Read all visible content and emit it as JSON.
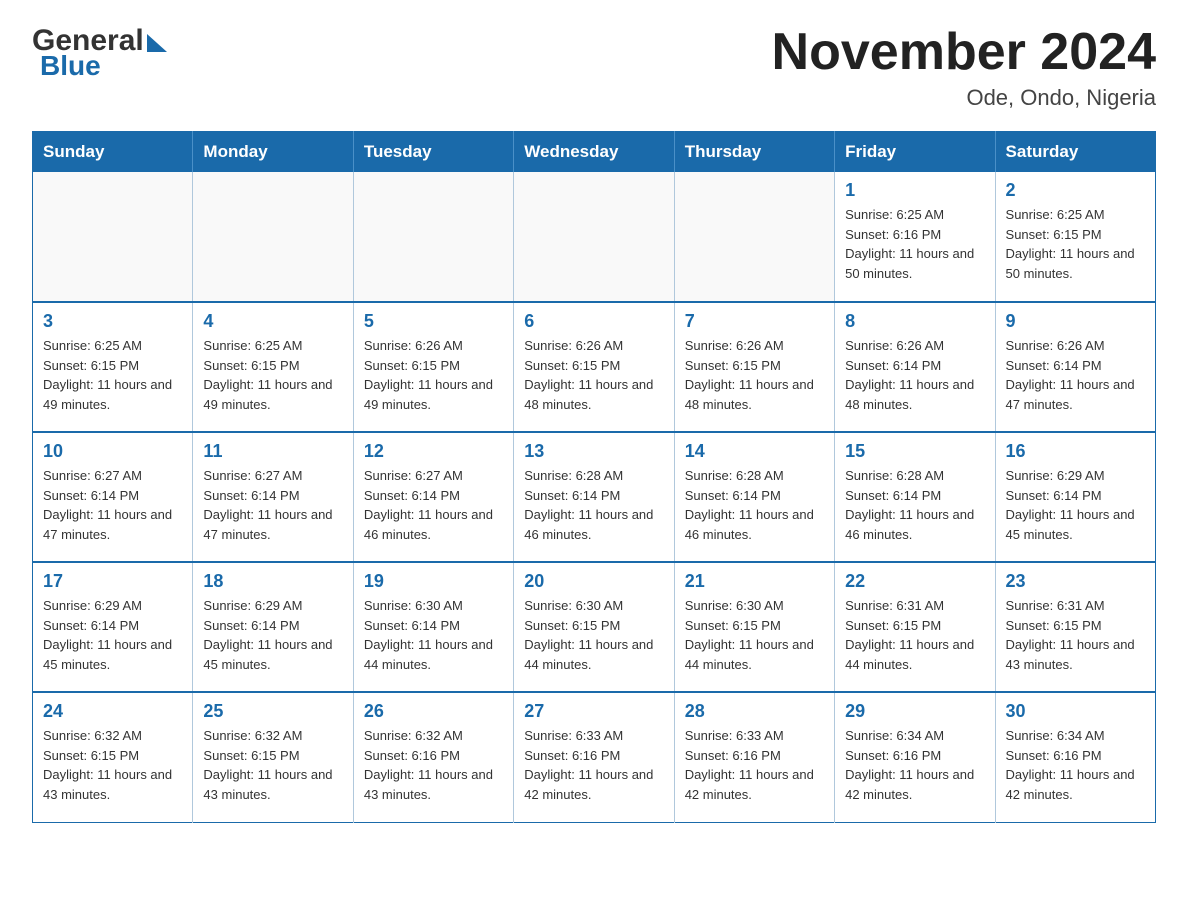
{
  "logo": {
    "general": "General",
    "blue": "Blue"
  },
  "header": {
    "title": "November 2024",
    "location": "Ode, Ondo, Nigeria"
  },
  "weekdays": [
    "Sunday",
    "Monday",
    "Tuesday",
    "Wednesday",
    "Thursday",
    "Friday",
    "Saturday"
  ],
  "weeks": [
    [
      {
        "day": "",
        "info": ""
      },
      {
        "day": "",
        "info": ""
      },
      {
        "day": "",
        "info": ""
      },
      {
        "day": "",
        "info": ""
      },
      {
        "day": "",
        "info": ""
      },
      {
        "day": "1",
        "info": "Sunrise: 6:25 AM\nSunset: 6:16 PM\nDaylight: 11 hours and 50 minutes."
      },
      {
        "day": "2",
        "info": "Sunrise: 6:25 AM\nSunset: 6:15 PM\nDaylight: 11 hours and 50 minutes."
      }
    ],
    [
      {
        "day": "3",
        "info": "Sunrise: 6:25 AM\nSunset: 6:15 PM\nDaylight: 11 hours and 49 minutes."
      },
      {
        "day": "4",
        "info": "Sunrise: 6:25 AM\nSunset: 6:15 PM\nDaylight: 11 hours and 49 minutes."
      },
      {
        "day": "5",
        "info": "Sunrise: 6:26 AM\nSunset: 6:15 PM\nDaylight: 11 hours and 49 minutes."
      },
      {
        "day": "6",
        "info": "Sunrise: 6:26 AM\nSunset: 6:15 PM\nDaylight: 11 hours and 48 minutes."
      },
      {
        "day": "7",
        "info": "Sunrise: 6:26 AM\nSunset: 6:15 PM\nDaylight: 11 hours and 48 minutes."
      },
      {
        "day": "8",
        "info": "Sunrise: 6:26 AM\nSunset: 6:14 PM\nDaylight: 11 hours and 48 minutes."
      },
      {
        "day": "9",
        "info": "Sunrise: 6:26 AM\nSunset: 6:14 PM\nDaylight: 11 hours and 47 minutes."
      }
    ],
    [
      {
        "day": "10",
        "info": "Sunrise: 6:27 AM\nSunset: 6:14 PM\nDaylight: 11 hours and 47 minutes."
      },
      {
        "day": "11",
        "info": "Sunrise: 6:27 AM\nSunset: 6:14 PM\nDaylight: 11 hours and 47 minutes."
      },
      {
        "day": "12",
        "info": "Sunrise: 6:27 AM\nSunset: 6:14 PM\nDaylight: 11 hours and 46 minutes."
      },
      {
        "day": "13",
        "info": "Sunrise: 6:28 AM\nSunset: 6:14 PM\nDaylight: 11 hours and 46 minutes."
      },
      {
        "day": "14",
        "info": "Sunrise: 6:28 AM\nSunset: 6:14 PM\nDaylight: 11 hours and 46 minutes."
      },
      {
        "day": "15",
        "info": "Sunrise: 6:28 AM\nSunset: 6:14 PM\nDaylight: 11 hours and 46 minutes."
      },
      {
        "day": "16",
        "info": "Sunrise: 6:29 AM\nSunset: 6:14 PM\nDaylight: 11 hours and 45 minutes."
      }
    ],
    [
      {
        "day": "17",
        "info": "Sunrise: 6:29 AM\nSunset: 6:14 PM\nDaylight: 11 hours and 45 minutes."
      },
      {
        "day": "18",
        "info": "Sunrise: 6:29 AM\nSunset: 6:14 PM\nDaylight: 11 hours and 45 minutes."
      },
      {
        "day": "19",
        "info": "Sunrise: 6:30 AM\nSunset: 6:14 PM\nDaylight: 11 hours and 44 minutes."
      },
      {
        "day": "20",
        "info": "Sunrise: 6:30 AM\nSunset: 6:15 PM\nDaylight: 11 hours and 44 minutes."
      },
      {
        "day": "21",
        "info": "Sunrise: 6:30 AM\nSunset: 6:15 PM\nDaylight: 11 hours and 44 minutes."
      },
      {
        "day": "22",
        "info": "Sunrise: 6:31 AM\nSunset: 6:15 PM\nDaylight: 11 hours and 44 minutes."
      },
      {
        "day": "23",
        "info": "Sunrise: 6:31 AM\nSunset: 6:15 PM\nDaylight: 11 hours and 43 minutes."
      }
    ],
    [
      {
        "day": "24",
        "info": "Sunrise: 6:32 AM\nSunset: 6:15 PM\nDaylight: 11 hours and 43 minutes."
      },
      {
        "day": "25",
        "info": "Sunrise: 6:32 AM\nSunset: 6:15 PM\nDaylight: 11 hours and 43 minutes."
      },
      {
        "day": "26",
        "info": "Sunrise: 6:32 AM\nSunset: 6:16 PM\nDaylight: 11 hours and 43 minutes."
      },
      {
        "day": "27",
        "info": "Sunrise: 6:33 AM\nSunset: 6:16 PM\nDaylight: 11 hours and 42 minutes."
      },
      {
        "day": "28",
        "info": "Sunrise: 6:33 AM\nSunset: 6:16 PM\nDaylight: 11 hours and 42 minutes."
      },
      {
        "day": "29",
        "info": "Sunrise: 6:34 AM\nSunset: 6:16 PM\nDaylight: 11 hours and 42 minutes."
      },
      {
        "day": "30",
        "info": "Sunrise: 6:34 AM\nSunset: 6:16 PM\nDaylight: 11 hours and 42 minutes."
      }
    ]
  ]
}
